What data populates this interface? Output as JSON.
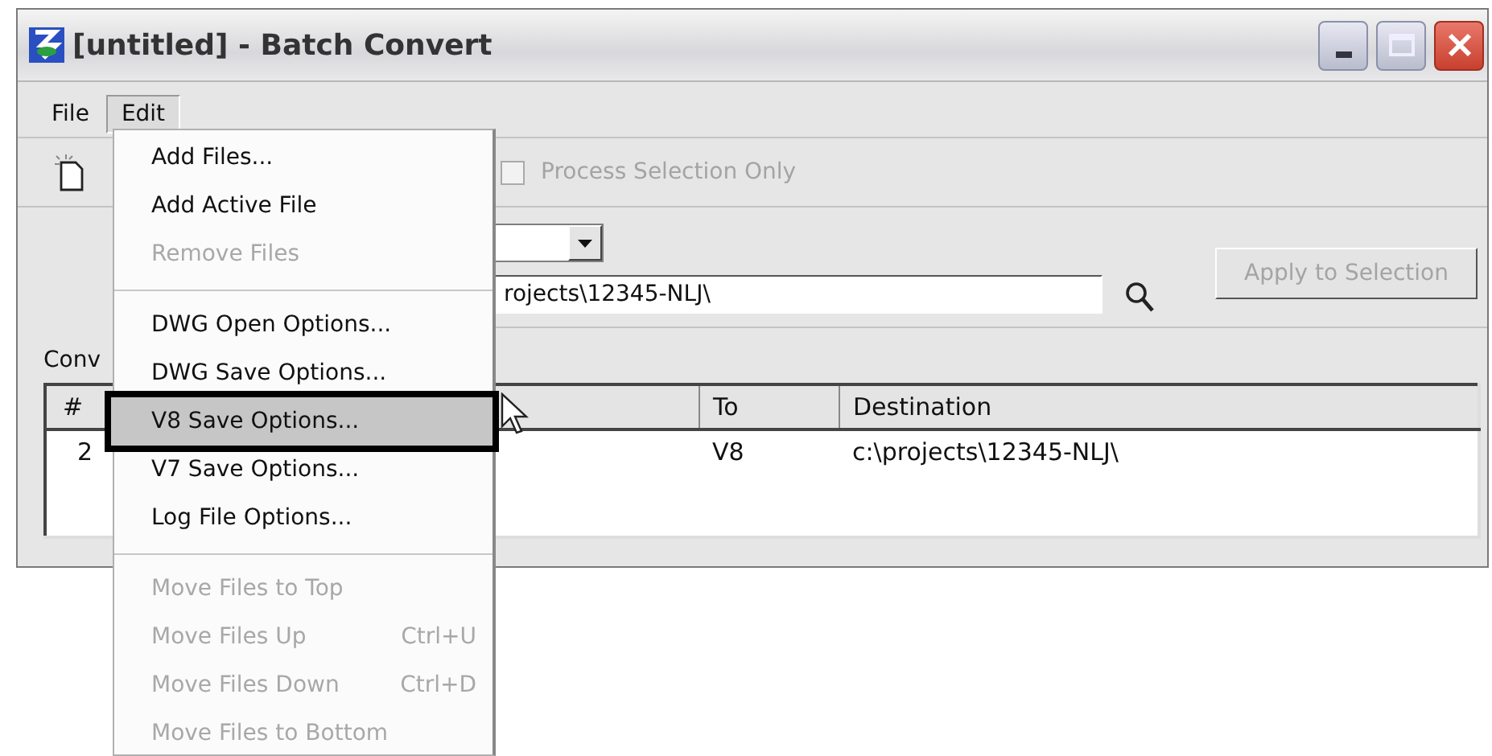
{
  "window": {
    "title": "[untitled] - Batch Convert"
  },
  "menubar": [
    {
      "label": "File",
      "selected": false
    },
    {
      "label": "Edit",
      "selected": true
    }
  ],
  "toolbar": {
    "process_selection_only": {
      "label": "Process Selection Only",
      "checked": false,
      "disabled": true
    }
  },
  "destination_field": {
    "value": "rojects\\12345-NLJ\\"
  },
  "apply_button": {
    "label": "Apply to Selection",
    "disabled": true
  },
  "section_label": "Conv",
  "table": {
    "columns": [
      "#",
      "To",
      "Destination"
    ],
    "rows": [
      {
        "cells": [
          "2",
          "V8",
          "c:\\projects\\12345-NLJ\\"
        ]
      }
    ]
  },
  "menu": {
    "items": [
      {
        "kind": "item",
        "label": "Add Files...",
        "disabled": false,
        "selected": false
      },
      {
        "kind": "item",
        "label": "Add Active File",
        "disabled": false,
        "selected": false
      },
      {
        "kind": "item",
        "label": "Remove Files",
        "disabled": true,
        "selected": false
      },
      {
        "kind": "separator"
      },
      {
        "kind": "item",
        "label": "DWG Open Options...",
        "disabled": false,
        "selected": false
      },
      {
        "kind": "item",
        "label": "DWG Save Options...",
        "disabled": false,
        "selected": false
      },
      {
        "kind": "item",
        "label": "V8 Save Options...",
        "disabled": false,
        "selected": true
      },
      {
        "kind": "item",
        "label": "V7 Save Options...",
        "disabled": false,
        "selected": false
      },
      {
        "kind": "item",
        "label": "Log File Options...",
        "disabled": false,
        "selected": false
      },
      {
        "kind": "separator"
      },
      {
        "kind": "item",
        "label": "Move Files to Top",
        "disabled": true,
        "selected": false
      },
      {
        "kind": "item",
        "label": "Move Files Up",
        "shortcut": "Ctrl+U",
        "disabled": true,
        "selected": false
      },
      {
        "kind": "item",
        "label": "Move Files Down",
        "shortcut": "Ctrl+D",
        "disabled": true,
        "selected": false
      },
      {
        "kind": "item",
        "label": "Move Files to Bottom",
        "disabled": true,
        "selected": false
      }
    ]
  }
}
